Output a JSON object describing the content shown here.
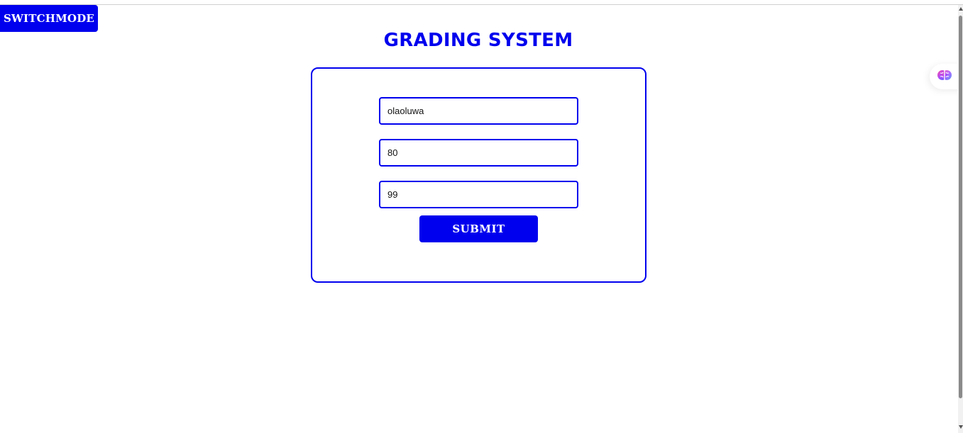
{
  "header": {
    "switch_label": "SWITCHMODE",
    "title": "GRADING SYSTEM"
  },
  "form": {
    "name_value": "olaoluwa",
    "score1_value": "80",
    "score2_value": "99",
    "submit_label": "SUBMIT"
  },
  "extension": {
    "icon": "brain-icon"
  },
  "colors": {
    "accent": "#0000ee",
    "background": "#ffffff"
  }
}
